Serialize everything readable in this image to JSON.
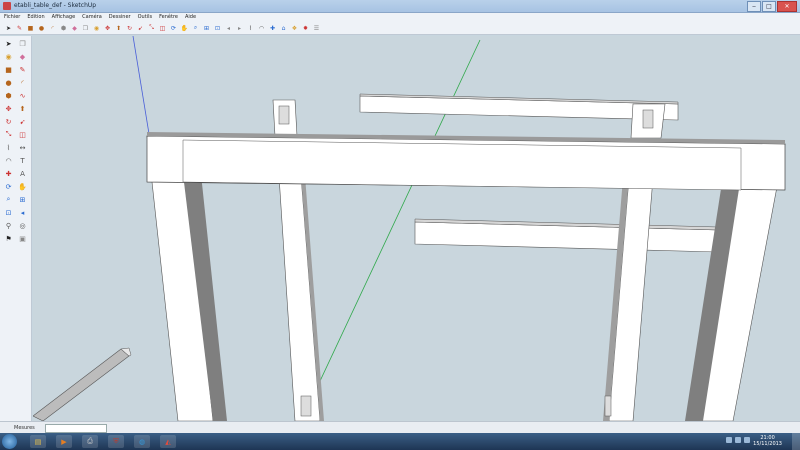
{
  "window": {
    "title": "etabli_table_def - SketchUp"
  },
  "menu": [
    "Fichier",
    "Edition",
    "Affichage",
    "Caméra",
    "Dessiner",
    "Outils",
    "Fenêtre",
    "Aide"
  ],
  "toolbar": [
    {
      "icon": "select-arrow-icon",
      "color": "#222"
    },
    {
      "icon": "line-pencil-icon",
      "color": "#c33"
    },
    {
      "icon": "rectangle-icon",
      "color": "#b5651d"
    },
    {
      "icon": "circle-icon",
      "color": "#b5651d"
    },
    {
      "icon": "arc-icon",
      "color": "#b5651d"
    },
    {
      "icon": "polygon-icon",
      "color": "#888"
    },
    {
      "icon": "eraser-icon",
      "color": "#d06f9b"
    },
    {
      "icon": "make-component-icon",
      "color": "#888"
    },
    {
      "icon": "paint-bucket-icon",
      "color": "#d8a030"
    },
    {
      "icon": "move-icon",
      "color": "#c33"
    },
    {
      "icon": "push-pull-icon",
      "color": "#b5651d"
    },
    {
      "icon": "rotate-icon",
      "color": "#c33"
    },
    {
      "icon": "follow-me-icon",
      "color": "#c33"
    },
    {
      "icon": "scale-icon",
      "color": "#c33"
    },
    {
      "icon": "offset-icon",
      "color": "#c33"
    },
    {
      "icon": "orbit-icon",
      "color": "#2a6bd1"
    },
    {
      "icon": "pan-icon",
      "color": "#2a6bd1"
    },
    {
      "icon": "zoom-icon",
      "color": "#2a6bd1"
    },
    {
      "icon": "zoom-window-icon",
      "color": "#2a6bd1"
    },
    {
      "icon": "zoom-extents-icon",
      "color": "#2a6bd1"
    },
    {
      "icon": "previous-view-icon",
      "color": "#888"
    },
    {
      "icon": "next-view-icon",
      "color": "#888"
    },
    {
      "icon": "tape-measure-icon",
      "color": "#555"
    },
    {
      "icon": "protractor-icon",
      "color": "#555"
    },
    {
      "icon": "axes-icon",
      "color": "#2a6bd1"
    },
    {
      "icon": "warehouse-icon",
      "color": "#2a6bd1"
    },
    {
      "icon": "components-icon",
      "color": "#d8a030"
    },
    {
      "icon": "extension-icon",
      "color": "#c33"
    },
    {
      "icon": "layers-icon",
      "color": "#888"
    }
  ],
  "sidebar": [
    {
      "icon": "select-arrow-icon",
      "color": "#222"
    },
    {
      "icon": "make-component-icon",
      "color": "#888"
    },
    {
      "icon": "paint-bucket-icon",
      "color": "#d8a030"
    },
    {
      "icon": "eraser-icon",
      "color": "#d06f9b"
    },
    {
      "icon": "rectangle-icon",
      "color": "#b5651d"
    },
    {
      "icon": "line-pencil-icon",
      "color": "#c33"
    },
    {
      "icon": "circle-icon",
      "color": "#b5651d"
    },
    {
      "icon": "arc-icon",
      "color": "#b5651d"
    },
    {
      "icon": "polygon-icon",
      "color": "#b5651d"
    },
    {
      "icon": "freehand-icon",
      "color": "#c33"
    },
    {
      "icon": "move-icon",
      "color": "#c33"
    },
    {
      "icon": "push-pull-icon",
      "color": "#b5651d"
    },
    {
      "icon": "rotate-icon",
      "color": "#c33"
    },
    {
      "icon": "follow-me-icon",
      "color": "#c33"
    },
    {
      "icon": "scale-icon",
      "color": "#c33"
    },
    {
      "icon": "offset-icon",
      "color": "#c33"
    },
    {
      "icon": "tape-measure-icon",
      "color": "#555"
    },
    {
      "icon": "dimension-icon",
      "color": "#555"
    },
    {
      "icon": "protractor-icon",
      "color": "#555"
    },
    {
      "icon": "text-icon",
      "color": "#555"
    },
    {
      "icon": "axes-icon",
      "color": "#c33"
    },
    {
      "icon": "3d-text-icon",
      "color": "#555"
    },
    {
      "icon": "orbit-icon",
      "color": "#2a6bd1"
    },
    {
      "icon": "pan-icon",
      "color": "#2a6bd1"
    },
    {
      "icon": "zoom-icon",
      "color": "#2a6bd1"
    },
    {
      "icon": "zoom-window-icon",
      "color": "#2a6bd1"
    },
    {
      "icon": "zoom-extents-icon",
      "color": "#2a6bd1"
    },
    {
      "icon": "previous-view-icon",
      "color": "#2a6bd1"
    },
    {
      "icon": "position-camera-icon",
      "color": "#555"
    },
    {
      "icon": "look-around-icon",
      "color": "#555"
    },
    {
      "icon": "walk-icon",
      "color": "#222"
    },
    {
      "icon": "section-plane-icon",
      "color": "#888"
    }
  ],
  "statusbar": {
    "measure_label": "Mesures"
  },
  "taskbar": {
    "time": "21:00",
    "date": "15/11/2013",
    "apps": [
      {
        "icon": "explorer-icon",
        "color": "#e8c04a"
      },
      {
        "icon": "media-player-icon",
        "color": "#e67e22"
      },
      {
        "icon": "printer-icon",
        "color": "#ccc"
      },
      {
        "icon": "antivirus-icon",
        "color": "#c0392b"
      },
      {
        "icon": "browser-icon",
        "color": "#3498db"
      },
      {
        "icon": "sketchup-icon",
        "color": "#e74c3c"
      }
    ]
  }
}
